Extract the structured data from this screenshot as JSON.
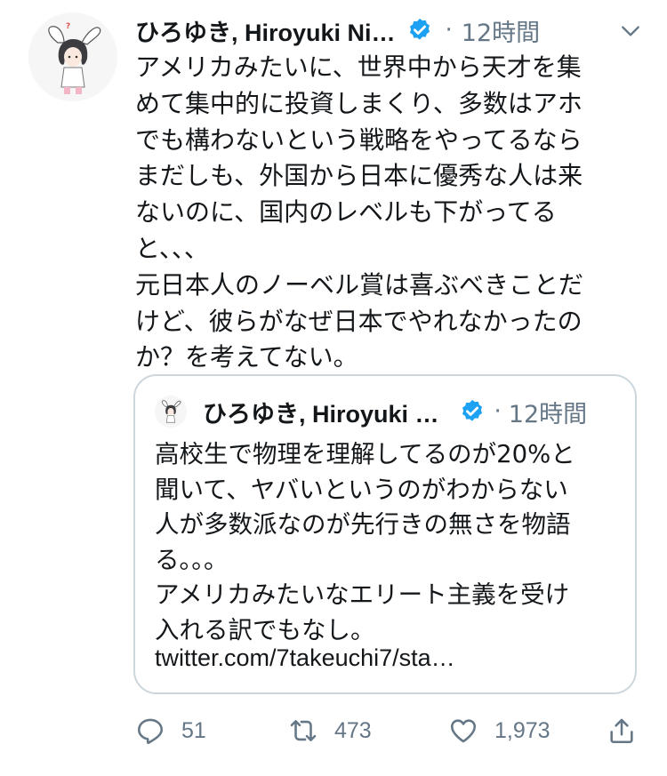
{
  "tweet": {
    "author_name": "ひろゆき, Hiroyuki Ni…",
    "separator": "·",
    "time": "12時間",
    "text": "アメリカみたいに、世界中から天才を集\nめて集中的に投資しまくり、多数はアホ\nでも構わないという戦略をやってるなら\nまだしも、外国から日本に優秀な人は来\nないのに、国内のレベルも下がってる\nと、、、\n元日本人のノーベル賞は喜ぶべきことだ\nけど、彼らがなぜ日本でやれなかったの\nか？を考えてない。"
  },
  "quoted_tweet": {
    "author_name": "ひろゆき, Hiroyuki …",
    "separator": "·",
    "time": "12時間",
    "text": "高校生で物理を理解してるのが20%と\n聞いて、ヤバいというのがわからない\n人が多数派なのが先行きの無さを物語\nる。。。\nアメリカみたいなエリート主義を受け\n入れる訳でもなし。",
    "link": "twitter.com/7takeuchi7/sta…"
  },
  "actions": {
    "reply_count": "51",
    "retweet_count": "473",
    "like_count": "1,973"
  },
  "colors": {
    "verified": "#1da1f2",
    "secondary_text": "#657786",
    "border": "#ccd6dd"
  },
  "icons": {
    "verified": "verified-badge-icon",
    "caret": "chevron-down-icon",
    "reply": "reply-icon",
    "retweet": "retweet-icon",
    "like": "heart-icon",
    "share": "share-icon"
  }
}
